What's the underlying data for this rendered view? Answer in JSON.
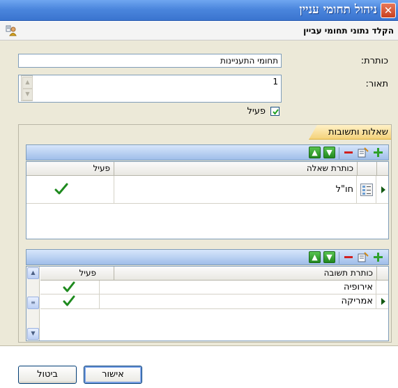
{
  "window": {
    "title": "ניהול תחומי עניין",
    "close_icon": "close-icon"
  },
  "header": {
    "caption": "הקלד נתוני תחומי עביין",
    "icon": "user-properties-icon"
  },
  "form": {
    "title_label": "כותרת:",
    "title_value": "תחומי התעניינות",
    "description_label": "תאור:",
    "description_value": "1",
    "active_label": "פעיל",
    "active_checked": true
  },
  "group": {
    "caption": "שאלות ותשובות"
  },
  "questions_grid": {
    "toolbar": [
      "add-icon",
      "properties-icon",
      "remove-icon",
      "move-down-icon",
      "move-up-icon"
    ],
    "columns": [
      "כותרת שאלה",
      "פעיל"
    ],
    "rows": [
      {
        "title": "חו\"ל",
        "active": true,
        "selected": true
      }
    ]
  },
  "answers_grid": {
    "toolbar": [
      "add-icon",
      "properties-icon",
      "remove-icon",
      "move-down-icon",
      "move-up-icon"
    ],
    "columns": [
      "כותרת תשובה",
      "פעיל"
    ],
    "rows": [
      {
        "title": "אירופיה",
        "active": true,
        "selected": false
      },
      {
        "title": "אמריקה",
        "active": true,
        "selected": true
      }
    ]
  },
  "buttons": {
    "ok": "אישור",
    "cancel": "ביטול"
  },
  "colors": {
    "titlebar": "#4b86dd",
    "panel": "#ece9d8",
    "group_tab": "#f4d27a",
    "check_green": "#1e8a1e",
    "toolbar": "#9fbde9"
  }
}
